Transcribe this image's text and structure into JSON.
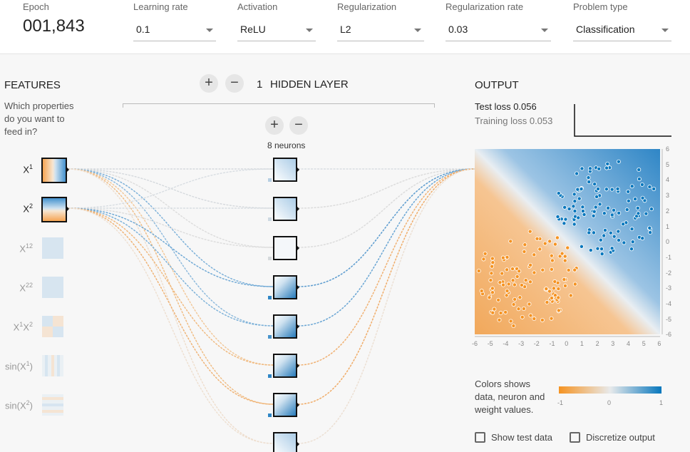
{
  "topbar": {
    "epoch_label": "Epoch",
    "epoch_value": "001,843",
    "learning_rate": {
      "label": "Learning rate",
      "value": "0.1"
    },
    "activation": {
      "label": "Activation",
      "value": "ReLU"
    },
    "regularization": {
      "label": "Regularization",
      "value": "L2"
    },
    "regularization_rate": {
      "label": "Regularization rate",
      "value": "0.03"
    },
    "problem_type": {
      "label": "Problem type",
      "value": "Classification"
    }
  },
  "features": {
    "title": "FEATURES",
    "subtitle_lines": [
      "Which properties",
      "do you want to",
      "feed in?"
    ],
    "items": [
      {
        "label": "X1",
        "active": true
      },
      {
        "label": "X2",
        "active": true
      },
      {
        "label": "X12",
        "active": false
      },
      {
        "label": "X22",
        "active": false
      },
      {
        "label": "X1X2",
        "active": false
      },
      {
        "label": "sin(X1)",
        "active": false
      },
      {
        "label": "sin(X2)",
        "active": false
      }
    ]
  },
  "network": {
    "add_layer": "+",
    "remove_layer": "−",
    "layer_count": "1",
    "layer_title": "HIDDEN LAYER",
    "add_neuron": "+",
    "remove_neuron": "−",
    "neurons_label": "8 neurons"
  },
  "output": {
    "title": "OUTPUT",
    "test_loss_label": "Test loss",
    "test_loss_value": "0.056",
    "training_loss_label": "Training loss",
    "training_loss_value": "0.053",
    "y_ticks": [
      "6",
      "5",
      "4",
      "3",
      "2",
      "1",
      "0",
      "-1",
      "-2",
      "-3",
      "-4",
      "-5",
      "-6"
    ],
    "x_ticks": [
      "-6",
      "-5",
      "-4",
      "-3",
      "-2",
      "-1",
      "0",
      "1",
      "2",
      "3",
      "4",
      "5",
      "6"
    ],
    "legend_lines": [
      "Colors shows",
      "data, neuron and",
      "weight values."
    ],
    "colorbar_ticks": [
      "-1",
      "0",
      "1"
    ],
    "show_test_data": "Show test data",
    "discretize_output": "Discretize output"
  },
  "colors": {
    "orange": "#f59322",
    "blue": "#0877bd",
    "bg": "#f7f7f7"
  }
}
